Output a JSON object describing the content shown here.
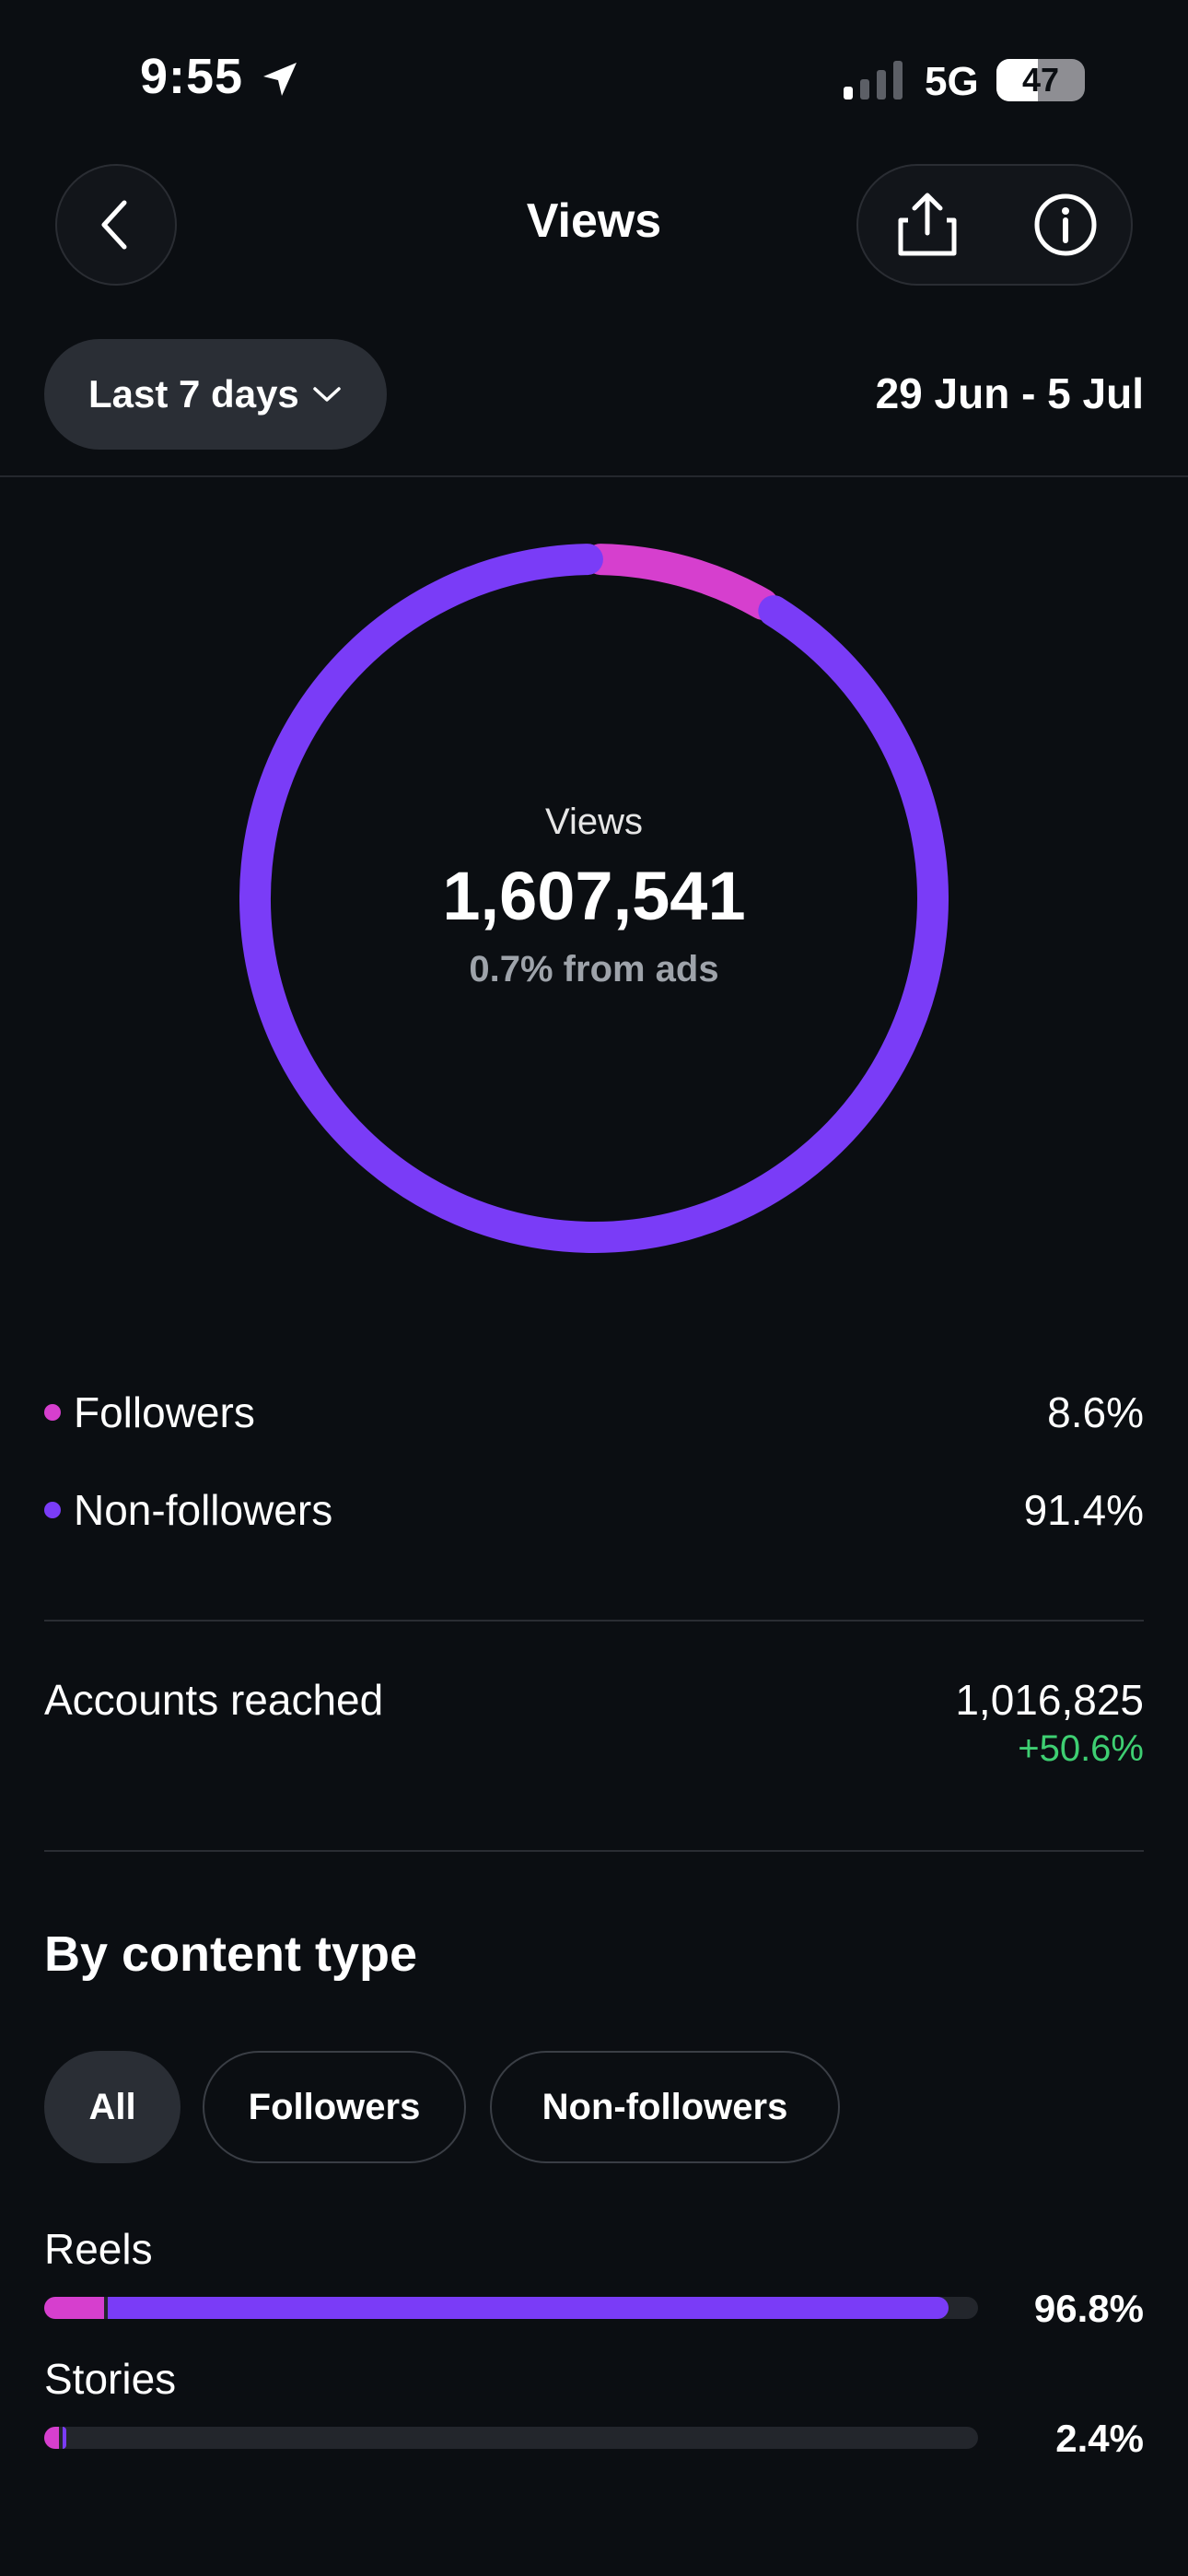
{
  "status_bar": {
    "time": "9:55",
    "network": "5G",
    "battery": "47",
    "battery_level": 0.47
  },
  "header": {
    "title": "Views",
    "back_icon": "chevron-left-icon",
    "share_icon": "share-icon",
    "info_icon": "info-icon"
  },
  "filter": {
    "range_label": "Last 7 days",
    "date_range": "29 Jun - 5 Jul"
  },
  "donut": {
    "label": "Views",
    "value": "1,607,541",
    "sub": "0.7% from ads"
  },
  "chart_data": {
    "type": "pie",
    "categories": [
      "Followers",
      "Non-followers"
    ],
    "values": [
      8.6,
      91.4
    ],
    "colors": [
      "#d63fce",
      "#7a3cf7"
    ]
  },
  "legend": {
    "items": [
      {
        "label": "Followers",
        "value": "8.6%",
        "color": "#d63fce"
      },
      {
        "label": "Non-followers",
        "value": "91.4%",
        "color": "#7a3cf7"
      }
    ]
  },
  "reach": {
    "label": "Accounts reached",
    "value": "1,016,825",
    "change": "+50.6%"
  },
  "content_type": {
    "title": "By content type",
    "chips": [
      "All",
      "Followers",
      "Non-followers"
    ],
    "rows": [
      {
        "label": "Reels",
        "value": "96.8%",
        "fraction": 0.968,
        "followers_fraction": 0.064
      },
      {
        "label": "Stories",
        "value": "2.4%",
        "fraction": 0.024,
        "followers_fraction": 0.016
      }
    ]
  },
  "colors": {
    "followers": "#d63fce",
    "non_followers": "#7a3cf7",
    "positive": "#3ecf72"
  }
}
